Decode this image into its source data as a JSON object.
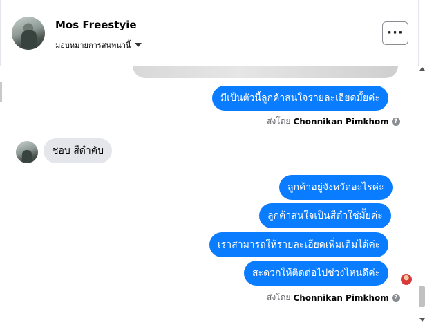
{
  "header": {
    "contact_name": "Mos Freestyie",
    "assign_label": "มอบหมายการสนทนานี้",
    "more_label": "···"
  },
  "messages": [
    {
      "direction": "outgoing",
      "text": "มีเป็นตัวนี้ลูกค้าสนใจรายละเอียดมั้ยค่ะ"
    },
    {
      "direction": "incoming",
      "text": "ชอบ สีดำคับ"
    },
    {
      "direction": "outgoing",
      "text": "ลูกค้าอยู่จังหวัดอะไรค่ะ"
    },
    {
      "direction": "outgoing",
      "text": "ลูกค้าสนใจเป็นสีดำใช่มั้ยค่ะ"
    },
    {
      "direction": "outgoing",
      "text": "เราสามารถให้รายละเอียดเพิ่มเติมได้ค่ะ"
    },
    {
      "direction": "outgoing",
      "text": "สะดวกให้ติดต่อไปช่วงไหนดีค่ะ"
    }
  ],
  "sent_by": {
    "prefix": "ส่งโดย",
    "agent": "Chonnikan Pimkhom",
    "info_glyph": "?"
  },
  "colors": {
    "outgoing_bubble": "#0a7cff",
    "incoming_bubble": "#e4e6eb",
    "meta_text": "#65676b"
  },
  "icons": [
    "chevron-down-icon",
    "more-options-icon",
    "info-icon"
  ]
}
